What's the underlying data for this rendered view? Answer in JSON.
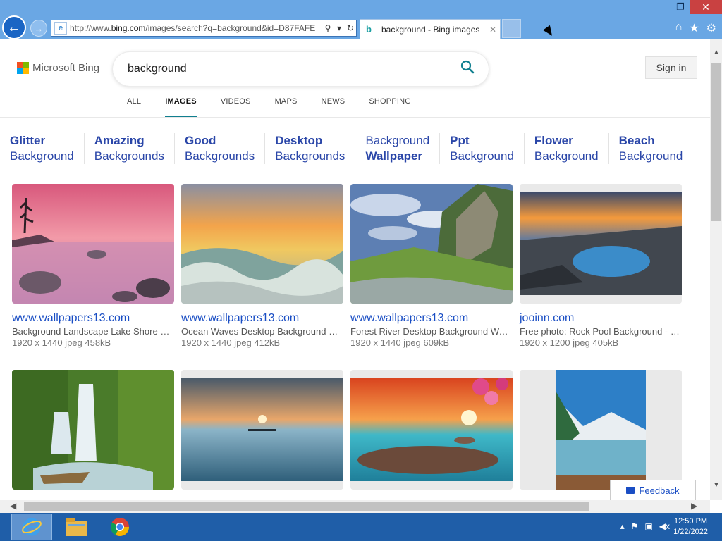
{
  "browser": {
    "url_prefix": "http://www.",
    "url_domain": "bing.com",
    "url_rest": "/images/search?q=background&id=D87FAFE",
    "tab_title": "background - Bing images",
    "window_controls": {
      "minimize": "—",
      "restore": "❐",
      "close": "✕"
    }
  },
  "header": {
    "logo_text": "Microsoft Bing",
    "search_query": "background",
    "sign_in_label": "Sign in",
    "scopes": [
      "ALL",
      "IMAGES",
      "VIDEOS",
      "MAPS",
      "NEWS",
      "SHOPPING"
    ],
    "active_scope": "IMAGES"
  },
  "related_searches": [
    {
      "line1": "Glitter",
      "line2": "Background",
      "bold": "line1"
    },
    {
      "line1": "Amazing",
      "line2": "Backgrounds",
      "bold": "line1"
    },
    {
      "line1": "Good",
      "line2": "Backgrounds",
      "bold": "line1"
    },
    {
      "line1": "Desktop",
      "line2": "Backgrounds",
      "bold": "line1"
    },
    {
      "line1": "Background",
      "line2": "Wallpaper",
      "bold": "line2"
    },
    {
      "line1": "Ppt",
      "line2": "Background",
      "bold": "line1"
    },
    {
      "line1": "Flower",
      "line2": "Background",
      "bold": "line1"
    },
    {
      "line1": "Beach",
      "line2": "Background",
      "bold": "line1"
    }
  ],
  "results": [
    {
      "site": "www.wallpapers13.com",
      "desc": "Background Landscape Lake Shore Desktop",
      "meta": "1920 x 1440 jpeg 458kB",
      "scene": "lake-pink"
    },
    {
      "site": "www.wallpapers13.com",
      "desc": "Ocean Waves Desktop Background Wallpaper",
      "meta": "1920 x 1440 jpeg 412kB",
      "scene": "ocean-waves"
    },
    {
      "site": "www.wallpapers13.com",
      "desc": "Forest River Desktop Background Wallpaper",
      "meta": "1920 x 1440 jpeg 609kB",
      "scene": "forest-river"
    },
    {
      "site": "jooinn.com",
      "desc": "Free photo: Rock Pool Background - Landscape",
      "meta": "1920 x 1200 jpeg 405kB",
      "scene": "rock-pool"
    },
    {
      "site": "",
      "desc": "",
      "meta": "",
      "scene": "waterfall"
    },
    {
      "site": "",
      "desc": "",
      "meta": "",
      "scene": "calm-sea"
    },
    {
      "site": "",
      "desc": "",
      "meta": "",
      "scene": "sunset-blossom"
    },
    {
      "site": "",
      "desc": "",
      "meta": "",
      "scene": "mountain-lake"
    }
  ],
  "feedback_label": "Feedback",
  "taskbar": {
    "apps": [
      "internet-explorer",
      "file-explorer",
      "chrome"
    ],
    "time": "12:50 PM",
    "date": "1/22/2022"
  }
}
